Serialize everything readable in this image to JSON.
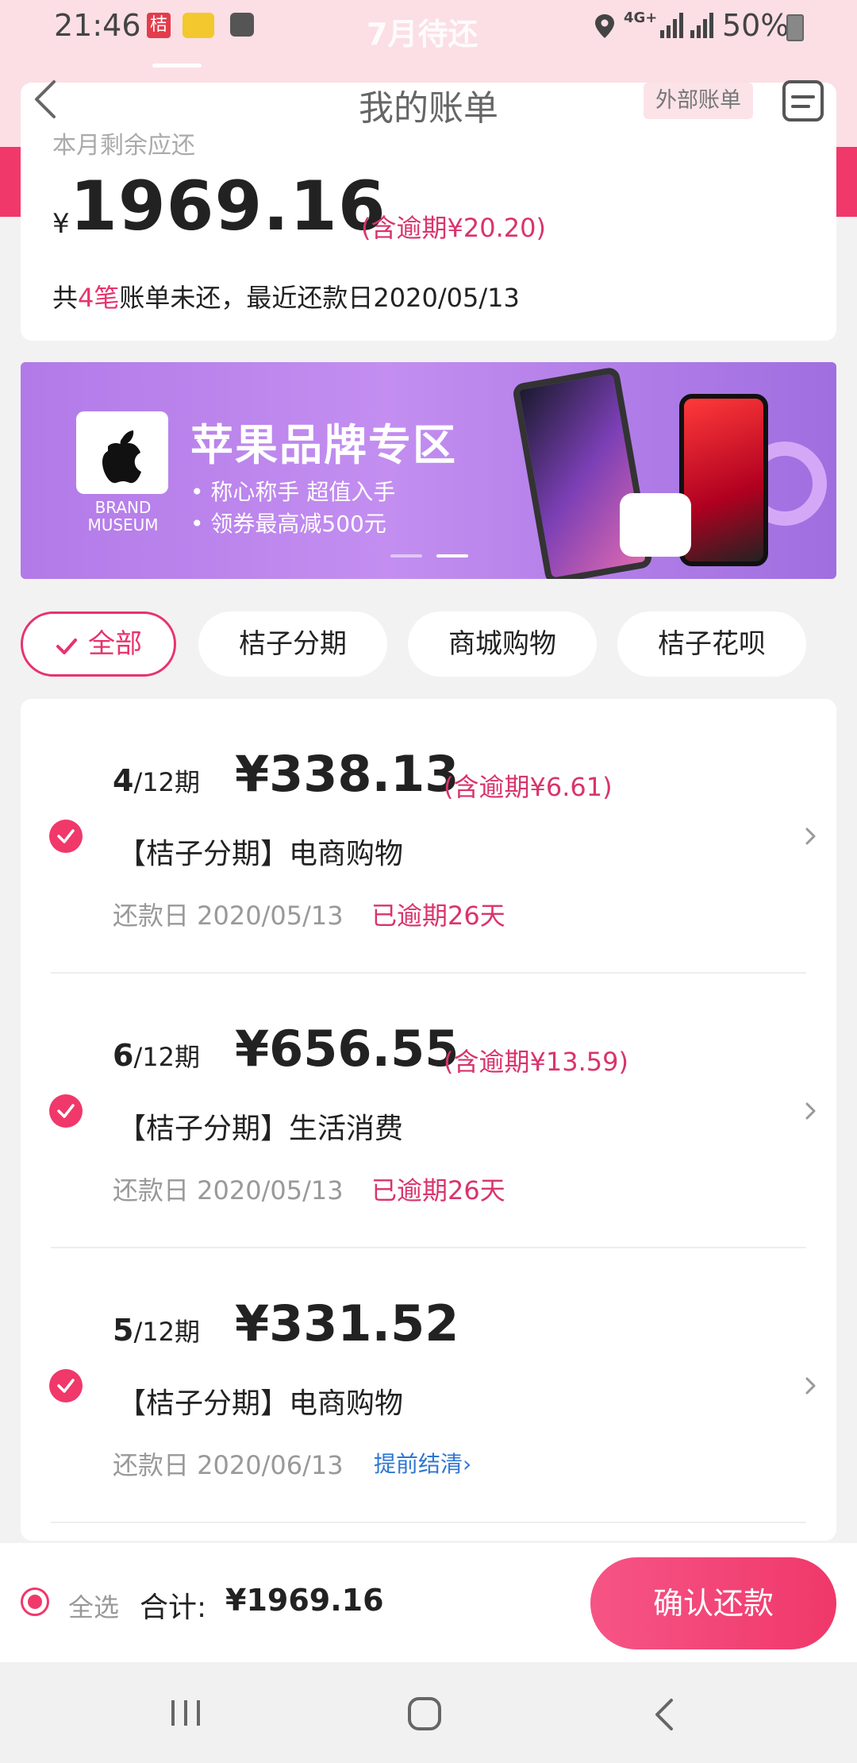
{
  "status_bar": {
    "time": "21:46",
    "app_badge": "桔",
    "tab_hint": "7月待还",
    "network": "4G+",
    "battery": "50%"
  },
  "header": {
    "title": "我的账单",
    "external_bill": "外部账单"
  },
  "summary": {
    "remaining_label": "本月剩余应还",
    "currency": "¥",
    "amount": "1969.16",
    "overdue_note": "(含逾期¥20.20)",
    "count_prefix": "共",
    "count": "4笔",
    "count_suffix": "账单未还，最近还款日2020/05/13"
  },
  "banner": {
    "brand_line1": "BRAND",
    "brand_line2": "MUSEUM",
    "title": "苹果品牌专区",
    "line1": "• 称心称手 超值入手",
    "line2": "• 领券最高减500元"
  },
  "filters": [
    "全部",
    "桔子分期",
    "商城购物",
    "桔子花呗"
  ],
  "bills": [
    {
      "period_current": "4",
      "period_total": "/12期",
      "amount": "¥338.13",
      "overdue_note": "(含逾期¥6.61)",
      "title": "【桔子分期】电商购物",
      "due": "还款日 2020/05/13",
      "status": "已逾期26天",
      "prepay": ""
    },
    {
      "period_current": "6",
      "period_total": "/12期",
      "amount": "¥656.55",
      "overdue_note": "(含逾期¥13.59)",
      "title": "【桔子分期】生活消费",
      "due": "还款日 2020/05/13",
      "status": "已逾期26天",
      "prepay": ""
    },
    {
      "period_current": "5",
      "period_total": "/12期",
      "amount": "¥331.52",
      "overdue_note": "",
      "title": "【桔子分期】电商购物",
      "due": "还款日 2020/06/13",
      "status": "",
      "prepay": "提前结清›"
    }
  ],
  "bottom": {
    "select_all": "全选",
    "total_label": "合计:",
    "total_value": "¥1969.16",
    "confirm": "确认还款"
  },
  "colors": {
    "accent": "#f0386a",
    "accent_text": "#e8336d",
    "link": "#2f76d2",
    "header_bg": "#fbdfe5"
  }
}
